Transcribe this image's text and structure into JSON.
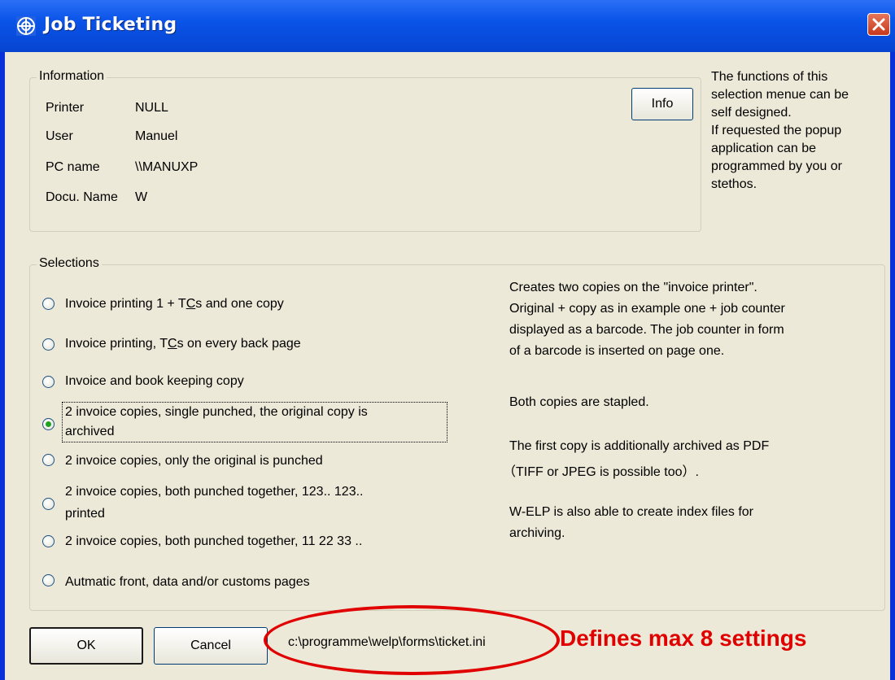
{
  "window": {
    "title": "Job Ticketing"
  },
  "information": {
    "legend": "Information",
    "rows": [
      {
        "label": "Printer",
        "value": "NULL"
      },
      {
        "label": "User",
        "value": "Manuel"
      },
      {
        "label": "PC name",
        "value": "\\\\MANUXP"
      },
      {
        "label": "Docu. Name",
        "value": "W"
      }
    ],
    "info_button": "Info"
  },
  "side_note": {
    "lines": [
      "The functions of this",
      "selection menue can be",
      "self designed.",
      "If requested the popup",
      "application can be",
      "programmed by you or",
      "stethos."
    ]
  },
  "selections": {
    "legend": "Selections",
    "selected_index": 3,
    "options": [
      {
        "pre": "Invoice printing 1 + T",
        "u": "C",
        "post": "s and one copy",
        "line2": ""
      },
      {
        "pre": "Invoice printing, T",
        "u": "C",
        "post": "s on every back page",
        "line2": ""
      },
      {
        "pre": "Invoice and book keeping copy",
        "u": "",
        "post": "",
        "line2": ""
      },
      {
        "pre": "2 invoice copies, single punched, the original copy is",
        "u": "",
        "post": "",
        "line2": "archived"
      },
      {
        "pre": "2 invoice copies, only the original is punched",
        "u": "",
        "post": "",
        "line2": ""
      },
      {
        "pre": "2 invoice copies, both punched together, 123.. 123..",
        "u": "",
        "post": "",
        "line2": "printed"
      },
      {
        "pre": "2 invoice copies, both punched together, 11 22 33 ..",
        "u": "",
        "post": "",
        "line2": ""
      },
      {
        "pre": "Autmatic front, data and/or customs pages",
        "u": "",
        "post": "",
        "line2": ""
      }
    ],
    "description": [
      "Creates two copies on the \"invoice printer\".",
      "Original + copy as in example one + job counter",
      "displayed as a barcode. The job counter in form",
      "of a barcode is inserted on page one.",
      "",
      "Both copies are stapled.",
      "",
      "The first copy is additionally archived as PDF",
      "（TIFF or JPEG is possible too）.",
      "",
      "W-ELP is also able to create index files for",
      "archiving."
    ]
  },
  "footer": {
    "ok": "OK",
    "cancel": "Cancel",
    "ini_path": "c:\\programme\\welp\\forms\\ticket.ini"
  },
  "annotation": {
    "text": "Defines max 8 settings",
    "color": "#e00000"
  }
}
